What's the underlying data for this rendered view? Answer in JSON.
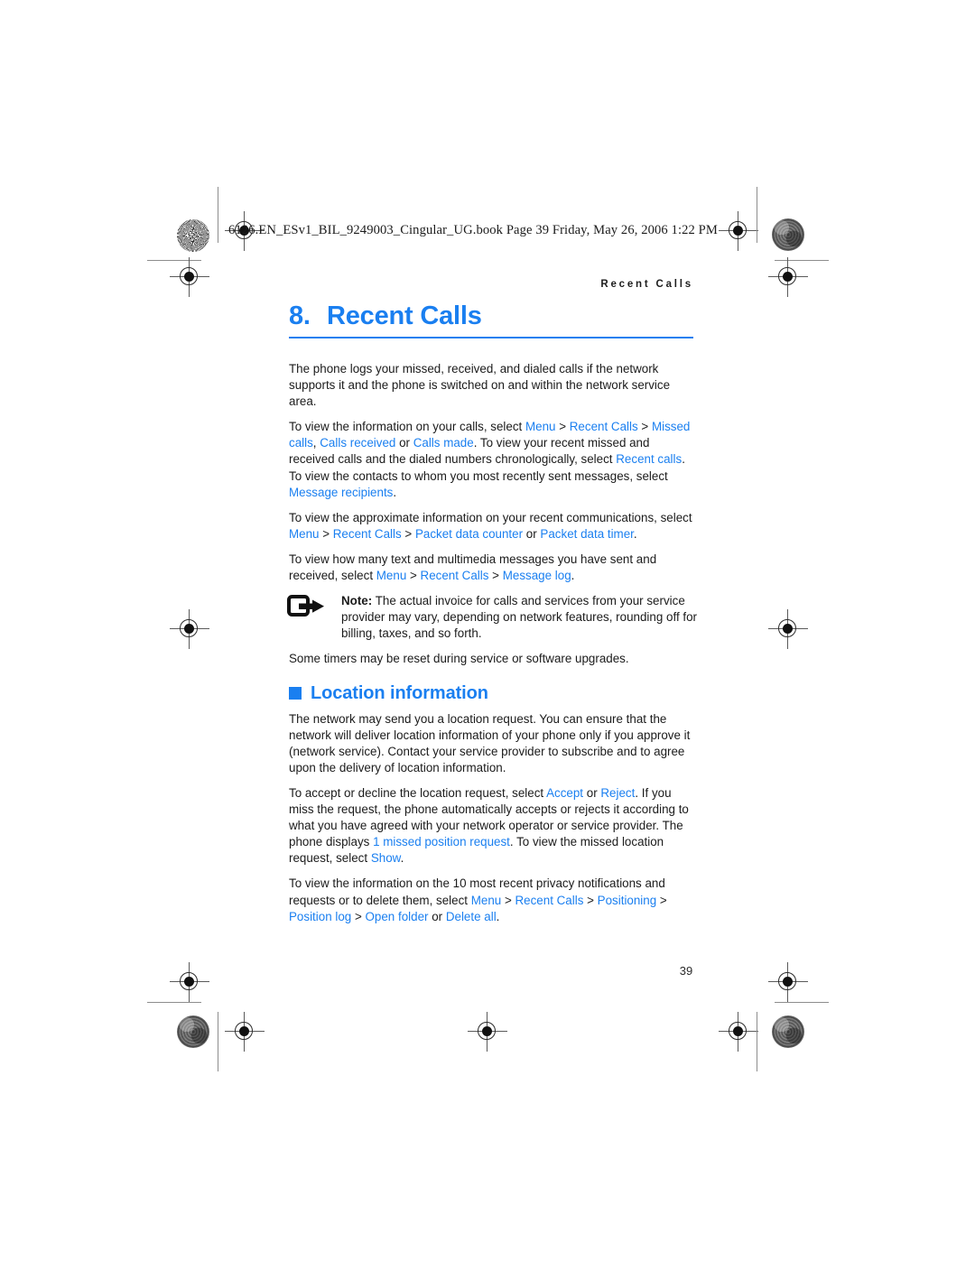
{
  "document": {
    "slug_line": "6126.EN_ESv1_BIL_9249003_Cingular_UG.book  Page 39  Friday, May 26, 2006  1:22 PM",
    "running_head": "Recent Calls",
    "page_number": "39",
    "accent_color": "#1a7ff0",
    "text_color": "#1b1b1b"
  },
  "chapter": {
    "number": "8.",
    "title": "Recent Calls"
  },
  "body": {
    "p1": "The phone logs your missed, received, and dialed calls if the network supports it and the phone is switched on and within the network service area.",
    "p2": {
      "lead": "To view the information on your calls, select ",
      "menu": "Menu",
      "sep1": " > ",
      "recent_calls": "Recent Calls",
      "missed_calls": "Missed calls",
      "comma1": ", ",
      "calls_received": "Calls received",
      "or1": " or ",
      "calls_made": "Calls made",
      "mid": ". To view your recent missed and received calls and the dialed numbers chronologically, select ",
      "recent_calls_item": "Recent calls",
      "mid2": ". To view the contacts to whom you most recently sent messages, select ",
      "message_recipients": "Message recipients",
      "end": "."
    },
    "p3": {
      "lead": "To view the approximate information on your recent communications, select ",
      "menu": "Menu",
      "sep1": " > ",
      "recent_calls": "Recent Calls",
      "packet_data_counter": "Packet data counter",
      "or1": " or ",
      "packet_data_timer": "Packet data timer",
      "end": "."
    },
    "p4": {
      "lead": "To view how many text and multimedia messages you have sent and received, select ",
      "menu": "Menu",
      "sep1": " > ",
      "recent_calls": "Recent Calls",
      "message_log": "Message log",
      "end": "."
    },
    "note": {
      "label": "Note:",
      "text": " The actual invoice for calls and services from your service provider may vary, depending on network features, rounding off for billing, taxes, and so forth."
    },
    "p5": "Some timers may be reset during service or software upgrades."
  },
  "location_section": {
    "heading": "Location information",
    "p1": "The network may send you a location request. You can ensure that the network will deliver location information of your phone only if you approve it (network service). Contact your service provider to subscribe and to agree upon the delivery of location information.",
    "p2": {
      "lead": "To accept or decline the location request, select ",
      "accept": "Accept",
      "or1": " or ",
      "reject": "Reject",
      "mid": ". If you miss the request, the phone automatically accepts or rejects it according to what you have agreed with your network operator or service provider. The phone displays ",
      "missed_position": "1 missed position request",
      "mid2": ". To view the missed location request, select ",
      "show": "Show",
      "end": "."
    },
    "p3": {
      "lead": "To view the information on the 10 most recent privacy notifications and requests or to delete them, select ",
      "menu": "Menu",
      "sep1": " > ",
      "recent_calls": "Recent Calls",
      "positioning": "Positioning",
      "position_log": "Position log",
      "open_folder": "Open folder",
      "or1": " or ",
      "delete_all": "Delete all",
      "end": "."
    }
  }
}
